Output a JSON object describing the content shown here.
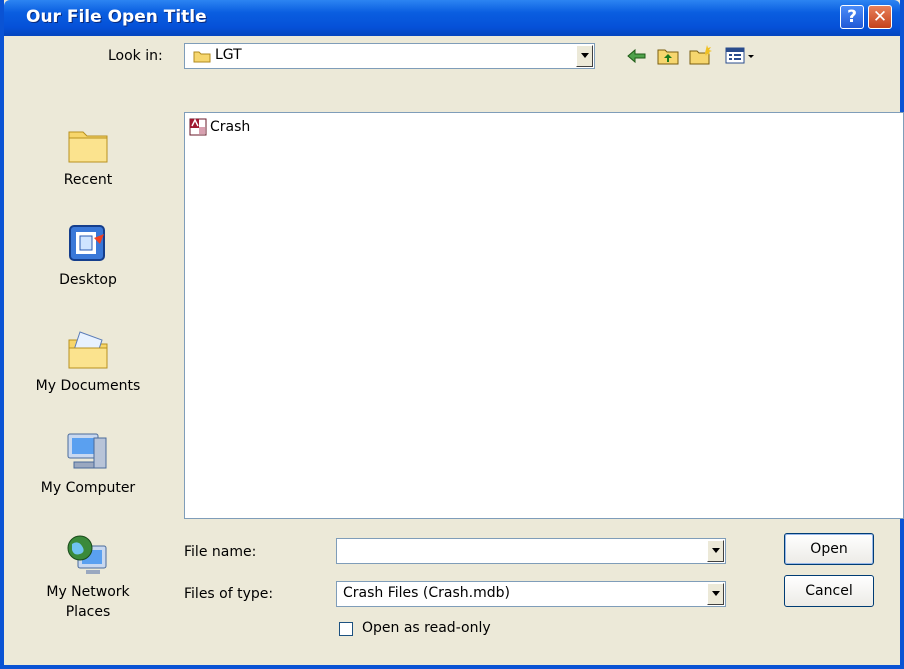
{
  "window": {
    "title": "Our File Open Title"
  },
  "title_buttons": {
    "help": "?",
    "close": "✕"
  },
  "look_in": {
    "label": "Look in:",
    "value": "LGT"
  },
  "toolbar": {
    "back_icon": "back-arrow-icon",
    "up_icon": "up-folder-icon",
    "new_folder_icon": "new-folder-icon",
    "views_icon": "views-menu-icon"
  },
  "places": [
    {
      "label": "Recent",
      "icon": "recent-folder-icon"
    },
    {
      "label": "Desktop",
      "icon": "desktop-icon"
    },
    {
      "label": "My Documents",
      "icon": "my-documents-icon"
    },
    {
      "label": "My Computer",
      "icon": "my-computer-icon"
    },
    {
      "label_line1": "My Network",
      "label_line2": "Places",
      "icon": "network-places-icon"
    }
  ],
  "files": [
    {
      "name": "Crash",
      "icon": "access-db-icon"
    }
  ],
  "file_name": {
    "label": "File name:",
    "value": ""
  },
  "file_type": {
    "label": "Files of type:",
    "value": "Crash Files (Crash.mdb)"
  },
  "read_only": {
    "label": "Open as read-only",
    "checked": false
  },
  "buttons": {
    "open": "Open",
    "cancel": "Cancel"
  }
}
